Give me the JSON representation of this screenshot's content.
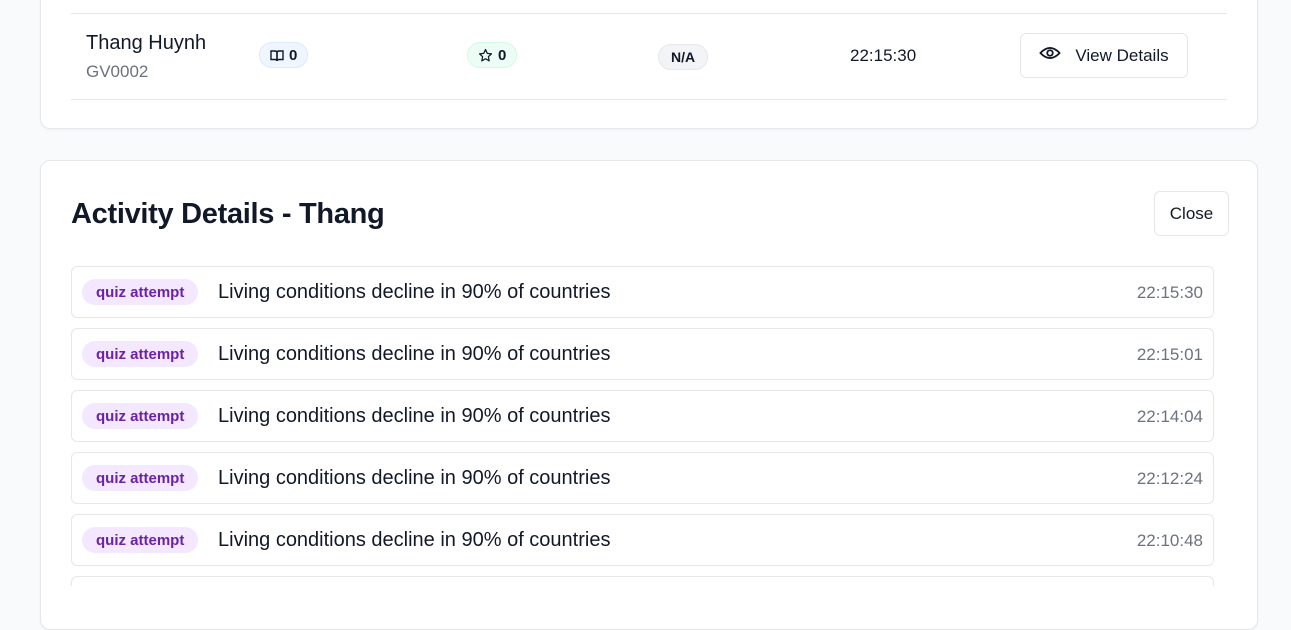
{
  "teacher_row": {
    "name": "Thang Huynh",
    "id": "GV0002",
    "lessons_count": "0",
    "stars_count": "0",
    "score": "N/A",
    "last_active": "22:15:30",
    "view_button": "View Details",
    "icons": {
      "lessons": "book-icon",
      "stars": "star-icon",
      "view": "eye-icon"
    }
  },
  "activity_panel": {
    "title": "Activity Details - Thang",
    "close_label": "Close",
    "items": [
      {
        "type": "quiz attempt",
        "title": "Living conditions decline in 90% of countries",
        "time": "22:15:30"
      },
      {
        "type": "quiz attempt",
        "title": "Living conditions decline in 90% of countries",
        "time": "22:15:01"
      },
      {
        "type": "quiz attempt",
        "title": "Living conditions decline in 90% of countries",
        "time": "22:14:04"
      },
      {
        "type": "quiz attempt",
        "title": "Living conditions decline in 90% of countries",
        "time": "22:12:24"
      },
      {
        "type": "quiz attempt",
        "title": "Living conditions decline in 90% of countries",
        "time": "22:10:48"
      },
      {
        "type": "",
        "title": "",
        "time": ""
      }
    ]
  },
  "colors": {
    "badge_bg": "#f3e8ff",
    "badge_text": "#6b21a8",
    "border": "#e5e7eb",
    "muted_text": "#6b7280"
  }
}
